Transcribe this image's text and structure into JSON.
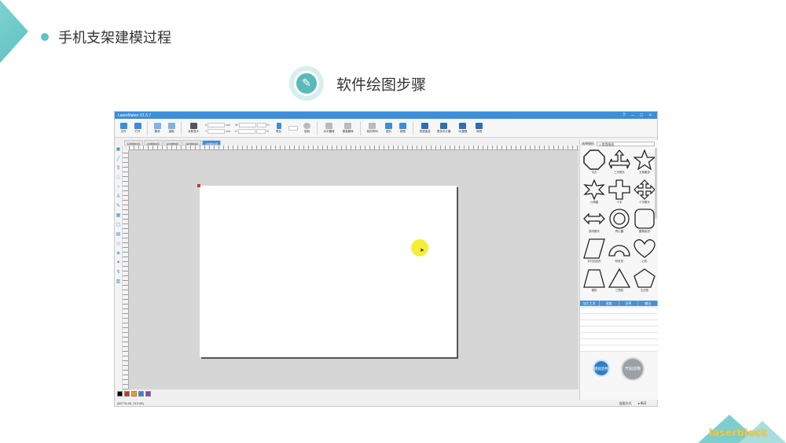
{
  "slide": {
    "title": "手机支架建模过程",
    "step_title": "软件绘图步骤",
    "logo_text": "laserblock",
    "accent": "#5ec3c2"
  },
  "app": {
    "window_title": "LaserMaker V1.5.7",
    "window_controls": "? – □ ×",
    "toolbar": [
      {
        "label": "文件",
        "icon": "folder-icon"
      },
      {
        "label": "打开",
        "icon": "open-icon"
      },
      {
        "label": "撤消",
        "icon": "undo-icon"
      },
      {
        "label": "重做",
        "icon": "redo-icon"
      },
      {
        "label": "对象显示",
        "icon": "grid-icon"
      },
      {
        "label": "等比",
        "icon": "lock-icon"
      },
      {
        "label": "旋转",
        "icon": "rotate-icon"
      },
      {
        "label": "水平翻转",
        "icon": "flip-h-icon"
      },
      {
        "label": "垂直翻转",
        "icon": "flip-v-icon"
      },
      {
        "label": "矩形阵列",
        "icon": "array-icon"
      },
      {
        "label": "图片",
        "icon": "image-icon"
      },
      {
        "label": "模型",
        "icon": "model-icon"
      },
      {
        "label": "快速造盒",
        "icon": "box-icon"
      },
      {
        "label": "更多设计器",
        "icon": "designer-icon"
      },
      {
        "label": "3D建模",
        "icon": "3d-icon"
      },
      {
        "label": "商城",
        "icon": "cart-icon"
      }
    ],
    "fields": {
      "x_label": "X",
      "y_label": "Y",
      "w_label": "W",
      "h_label": "H",
      "unit": "mm",
      "scale": "100",
      "pct": "%",
      "rotate_value": "0"
    },
    "tabs": [
      "Untitled4",
      "Untitled3",
      "Untitled2",
      "Untitled1",
      "Untitled5"
    ],
    "shape_library": {
      "label": "选择图形:",
      "selected": "1.常用图形",
      "shapes": [
        "8边",
        "三叉箭头",
        "五角星形",
        "六角星",
        "十字",
        "十字箭头",
        "双向箭头",
        "同心圆",
        "圆角矩形",
        "平行四边形",
        "彩虹形",
        "心形",
        "梯形",
        "三角形",
        "五边形"
      ]
    },
    "process_table": {
      "headers": [
        "加工工艺",
        "速度",
        "功率",
        "输出"
      ]
    },
    "buttons": {
      "simulate": "模拟造物",
      "start": "开始造物"
    },
    "status": {
      "coords": "(82778.06, 213.08)",
      "conn_label": "连接方式",
      "conn_state": "断开"
    },
    "palette": [
      "#000000",
      "#c0392b",
      "#f39c12",
      "#2e86de",
      "#8e44ad"
    ]
  }
}
